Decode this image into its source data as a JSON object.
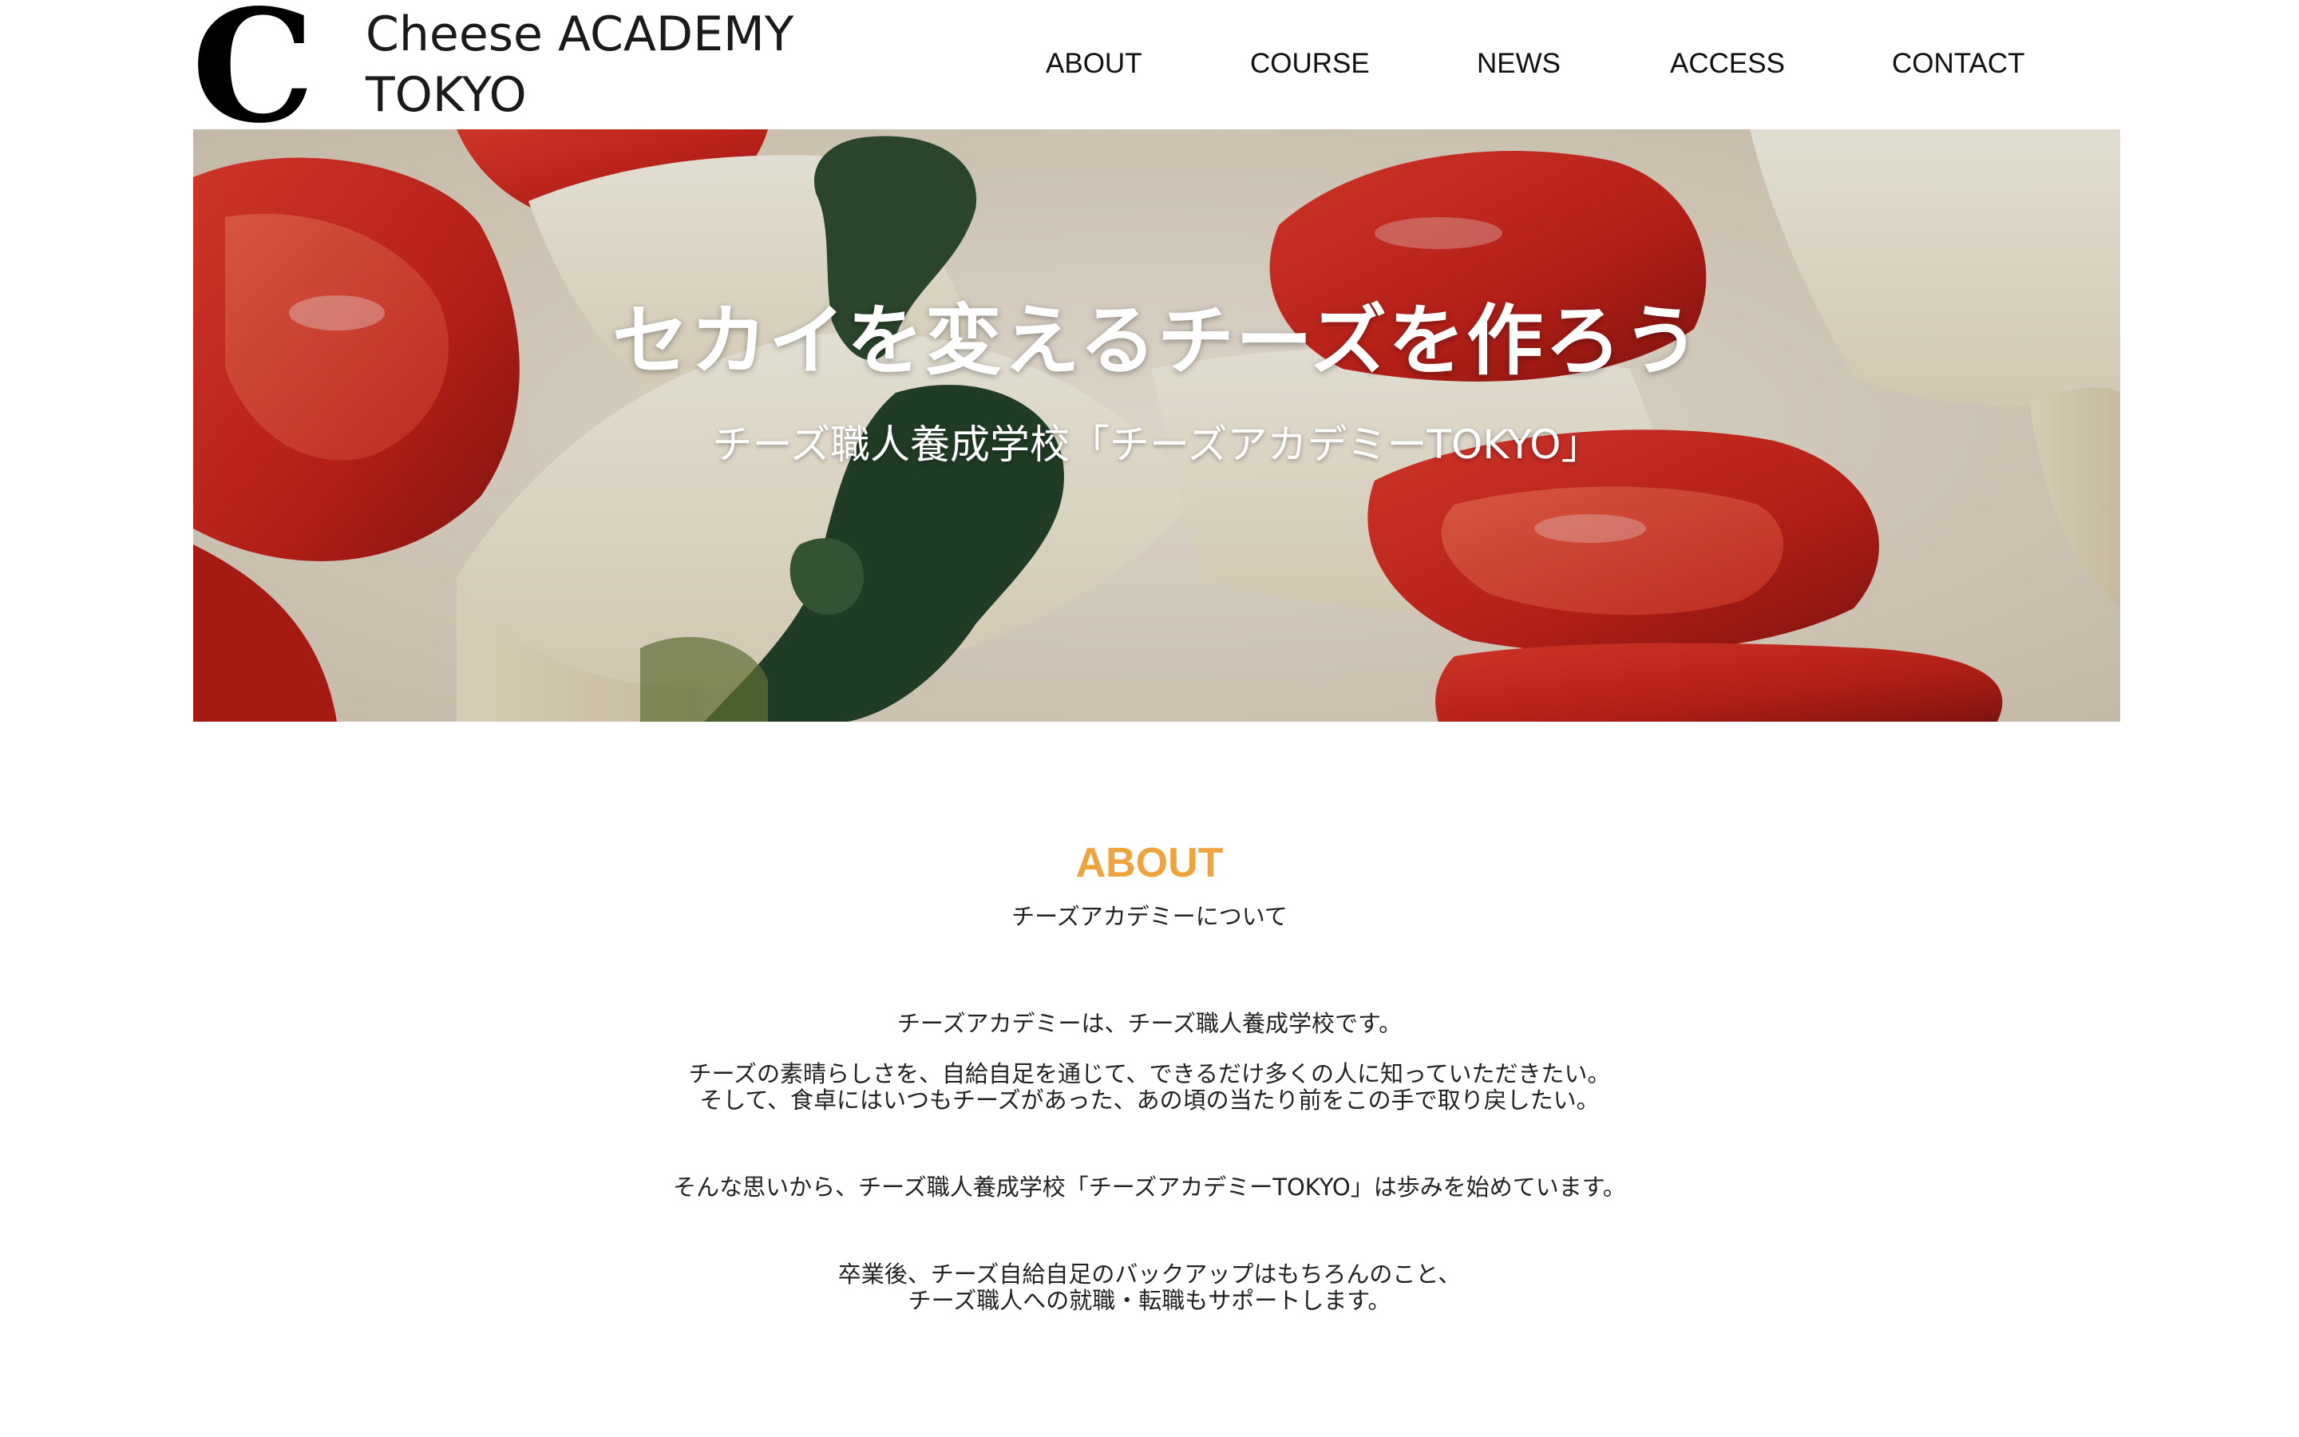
{
  "header": {
    "logo": {
      "mark": "C",
      "line1": "Cheese ACADEMY",
      "line2": "TOKYO"
    },
    "nav": [
      {
        "label": "ABOUT"
      },
      {
        "label": "COURSE"
      },
      {
        "label": "NEWS"
      },
      {
        "label": "ACCESS"
      },
      {
        "label": "CONTACT"
      }
    ]
  },
  "hero": {
    "title": "セカイを変えるチーズを作ろう",
    "subtitle": "チーズ職人養成学校「チーズアカデミーTOKYO」",
    "image_alt": "cheese-and-tomato-photo"
  },
  "about": {
    "heading": "ABOUT",
    "subheading": "チーズアカデミーについて",
    "paragraphs": [
      [
        "チーズアカデミーは、チーズ職人養成学校です。"
      ],
      [
        "チーズの素晴らしさを、自給自足を通じて、できるだけ多くの人に知っていただきたい。",
        "そして、食卓にはいつもチーズがあった、あの頃の当たり前をこの手で取り戻したい。"
      ],
      [
        "そんな思いから、チーズ職人養成学校「チーズアカデミーTOKYO」は歩みを始めています。"
      ],
      [
        "卒業後、チーズ自給自足のバックアップはもちろんのこと、",
        "チーズ職人への就職・転職もサポートします。"
      ]
    ]
  },
  "colors": {
    "accent": "#f0a33c",
    "text": "#222222",
    "background": "#ffffff"
  }
}
